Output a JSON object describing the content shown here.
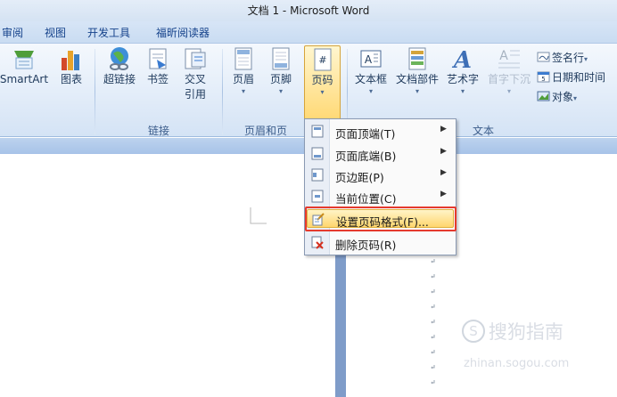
{
  "window": {
    "title": "文档 1 - Microsoft Word"
  },
  "tabs": [
    {
      "label": "审阅"
    },
    {
      "label": "视图"
    },
    {
      "label": "开发工具"
    },
    {
      "label": "福昕阅读器"
    }
  ],
  "ribbon": {
    "illustrations": {
      "smartart": "SmartArt",
      "chart": "图表"
    },
    "links": {
      "hyperlink": "超链接",
      "bookmark": "书签",
      "cross_ref_1": "交叉",
      "cross_ref_2": "引用",
      "group": "链接"
    },
    "header_footer": {
      "header": "页眉",
      "footer": "页脚",
      "page_number": "页码",
      "group": "页眉和页"
    },
    "text": {
      "textbox": "文本框",
      "quickparts": "文档部件",
      "wordart": "艺术字",
      "dropcap": "首字下沉",
      "signature": "签名行",
      "datetime": "日期和时间",
      "object": "对象",
      "group": "文本"
    },
    "dropdown_arrow": "▾"
  },
  "page_number_menu": {
    "items": [
      {
        "label": "页面顶端(T)",
        "submenu": true,
        "icon": "page-top-icon"
      },
      {
        "label": "页面底端(B)",
        "submenu": true,
        "icon": "page-bottom-icon"
      },
      {
        "label": "页边距(P)",
        "submenu": true,
        "icon": "page-margin-icon"
      },
      {
        "label": "当前位置(C)",
        "submenu": true,
        "icon": "current-position-icon"
      },
      {
        "label": "设置页码格式(F)...",
        "submenu": false,
        "active": true,
        "icon": "format-page-number-icon"
      },
      {
        "label": "删除页码(R)",
        "submenu": false,
        "icon": "remove-page-number-icon"
      }
    ],
    "submenu_arrow": "▶"
  },
  "watermark": {
    "brand": "搜狗指南",
    "domain": "zhinan.sogou.com"
  },
  "colors": {
    "highlight": "#ffd66e",
    "annotation_red": "#e53a2e",
    "ribbon_bg": "#e3edf9",
    "tab_text": "#15428b"
  }
}
